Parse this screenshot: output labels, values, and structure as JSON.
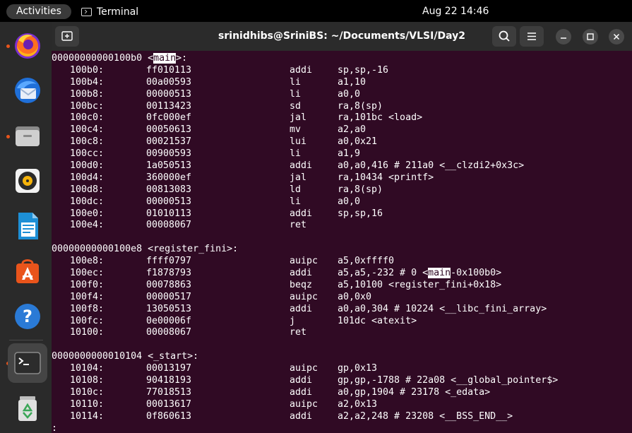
{
  "topbar": {
    "activities_label": "Activities",
    "app_name": "Terminal",
    "clock": "Aug 22  14:46"
  },
  "dock": {
    "items": [
      {
        "name": "Firefox",
        "icon": "firefox-icon",
        "running": true
      },
      {
        "name": "Thunderbird",
        "icon": "thunderbird-icon",
        "running": false
      },
      {
        "name": "Files",
        "icon": "files-icon",
        "running": true
      },
      {
        "name": "Rhythmbox",
        "icon": "rhythmbox-icon",
        "running": false
      },
      {
        "name": "LibreOffice Writer",
        "icon": "writer-icon",
        "running": false
      },
      {
        "name": "Ubuntu Software",
        "icon": "software-icon",
        "running": false
      },
      {
        "name": "Help",
        "icon": "help-icon",
        "running": false
      },
      {
        "name": "Terminal",
        "icon": "terminal-icon",
        "running": true
      },
      {
        "name": "Trash",
        "icon": "trash-icon",
        "running": false
      }
    ]
  },
  "window": {
    "title": "srinidhibs@SriniBS: ~/Documents/VLSI/Day2"
  },
  "colors": {
    "terminal_bg": "#300a24",
    "headerbar_bg": "#2b2b2b",
    "dock_bg": "#2a2a2a",
    "accent_orange": "#e9541b"
  },
  "terminal": {
    "sections": [
      {
        "label_prefix": "00000000000100b0 <",
        "label_highlight": "main",
        "label_suffix": ">:",
        "rows": [
          {
            "addr": "100b0:",
            "hex": "ff010113",
            "mn": "addi",
            "op": "sp,sp,-16"
          },
          {
            "addr": "100b4:",
            "hex": "00a00593",
            "mn": "li",
            "op": "a1,10"
          },
          {
            "addr": "100b8:",
            "hex": "00000513",
            "mn": "li",
            "op": "a0,0"
          },
          {
            "addr": "100bc:",
            "hex": "00113423",
            "mn": "sd",
            "op": "ra,8(sp)"
          },
          {
            "addr": "100c0:",
            "hex": "0fc000ef",
            "mn": "jal",
            "op": "ra,101bc <load>"
          },
          {
            "addr": "100c4:",
            "hex": "00050613",
            "mn": "mv",
            "op": "a2,a0"
          },
          {
            "addr": "100c8:",
            "hex": "00021537",
            "mn": "lui",
            "op": "a0,0x21"
          },
          {
            "addr": "100cc:",
            "hex": "00900593",
            "mn": "li",
            "op": "a1,9"
          },
          {
            "addr": "100d0:",
            "hex": "1a050513",
            "mn": "addi",
            "op": "a0,a0,416 # 211a0 <__clzdi2+0x3c>"
          },
          {
            "addr": "100d4:",
            "hex": "360000ef",
            "mn": "jal",
            "op": "ra,10434 <printf>"
          },
          {
            "addr": "100d8:",
            "hex": "00813083",
            "mn": "ld",
            "op": "ra,8(sp)"
          },
          {
            "addr": "100dc:",
            "hex": "00000513",
            "mn": "li",
            "op": "a0,0"
          },
          {
            "addr": "100e0:",
            "hex": "01010113",
            "mn": "addi",
            "op": "sp,sp,16"
          },
          {
            "addr": "100e4:",
            "hex": "00008067",
            "mn": "ret",
            "op": ""
          }
        ]
      },
      {
        "label_prefix": "00000000000100e8 <register_fini>:",
        "label_highlight": "",
        "label_suffix": "",
        "rows": [
          {
            "addr": "100e8:",
            "hex": "ffff0797",
            "mn": "auipc",
            "op": "a5,0xffff0"
          },
          {
            "addr": "100ec:",
            "hex": "f1878793",
            "mn": "addi",
            "op": "a5,a5,-232 # 0 <",
            "op_hl": "main",
            "op_tail": "-0x100b0>"
          },
          {
            "addr": "100f0:",
            "hex": "00078863",
            "mn": "beqz",
            "op": "a5,10100 <register_fini+0x18>"
          },
          {
            "addr": "100f4:",
            "hex": "00000517",
            "mn": "auipc",
            "op": "a0,0x0"
          },
          {
            "addr": "100f8:",
            "hex": "13050513",
            "mn": "addi",
            "op": "a0,a0,304 # 10224 <__libc_fini_array>"
          },
          {
            "addr": "100fc:",
            "hex": "0e00006f",
            "mn": "j",
            "op": "101dc <atexit>"
          },
          {
            "addr": "10100:",
            "hex": "00008067",
            "mn": "ret",
            "op": ""
          }
        ]
      },
      {
        "label_prefix": "0000000000010104 <_start>:",
        "label_highlight": "",
        "label_suffix": "",
        "rows": [
          {
            "addr": "10104:",
            "hex": "00013197",
            "mn": "auipc",
            "op": "gp,0x13"
          },
          {
            "addr": "10108:",
            "hex": "90418193",
            "mn": "addi",
            "op": "gp,gp,-1788 # 22a08 <__global_pointer$>"
          },
          {
            "addr": "1010c:",
            "hex": "77018513",
            "mn": "addi",
            "op": "a0,gp,1904 # 23178 <_edata>"
          },
          {
            "addr": "10110:",
            "hex": "00013617",
            "mn": "auipc",
            "op": "a2,0x13"
          },
          {
            "addr": "10114:",
            "hex": "0f860613",
            "mn": "addi",
            "op": "a2,a2,248 # 23208 <__BSS_END__>"
          }
        ]
      }
    ],
    "prompt_line": ":"
  }
}
